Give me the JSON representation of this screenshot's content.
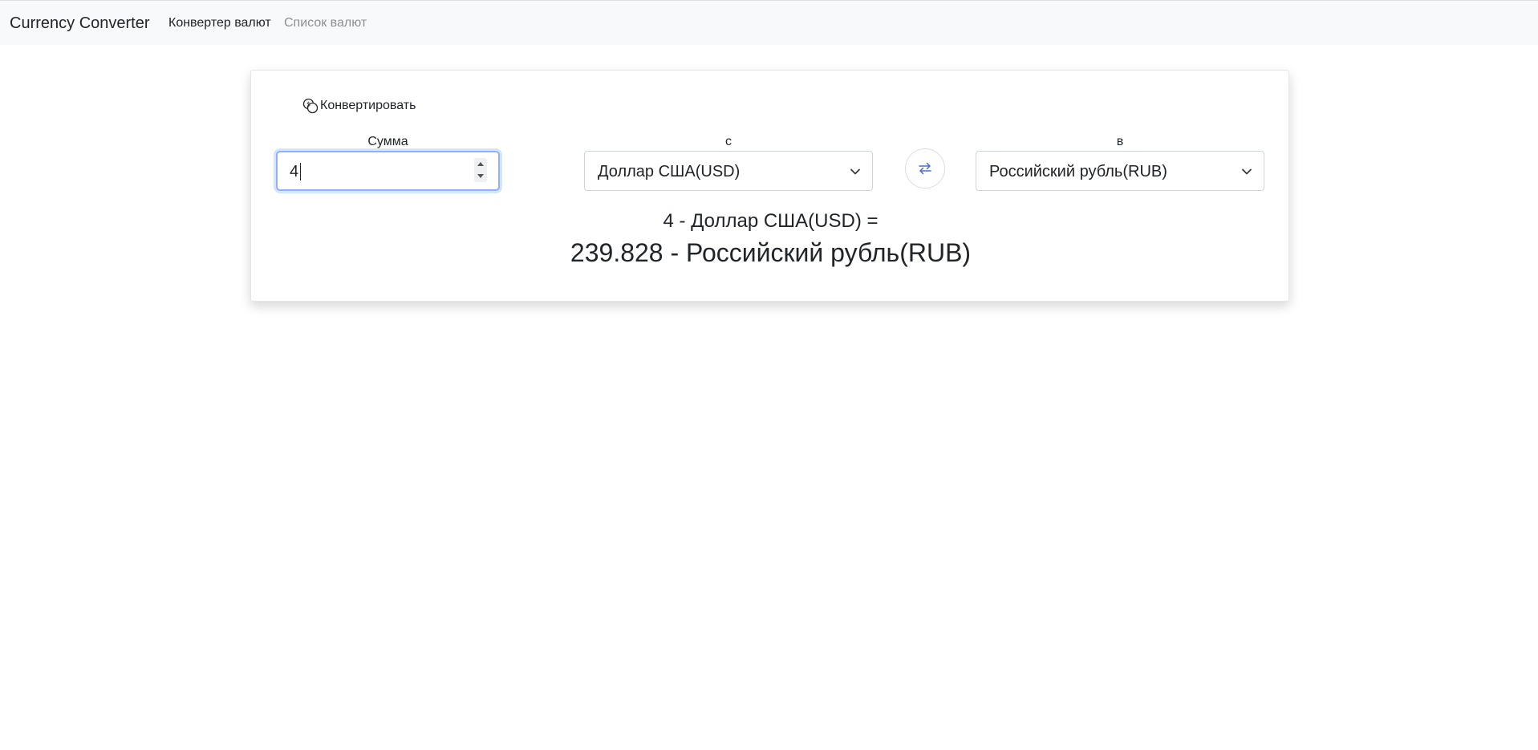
{
  "navbar": {
    "brand": "Currency Converter",
    "links": [
      {
        "label": "Конвертер валют",
        "active": true
      },
      {
        "label": "Список валют",
        "active": false
      }
    ]
  },
  "converter": {
    "convert_label": "Конвертировать",
    "amount_label": "Сумма",
    "amount_value": "4",
    "from_label": "с",
    "from_currency": "Доллар США(USD)",
    "to_label": "в",
    "to_currency": "Российский рубль(RUB)",
    "result_source": "4 - Доллар США(USD) =",
    "result_target": "239.828 - Российский рубль(RUB)"
  },
  "colors": {
    "navbar_bg": "#f8f9fa",
    "focus_border": "#8fb0ff",
    "swap_icon": "#4b6bdc"
  },
  "icons": {
    "convert": "currency-exchange-icon",
    "swap": "swap-arrows-icon",
    "dropdown": "chevron-down-icon"
  }
}
